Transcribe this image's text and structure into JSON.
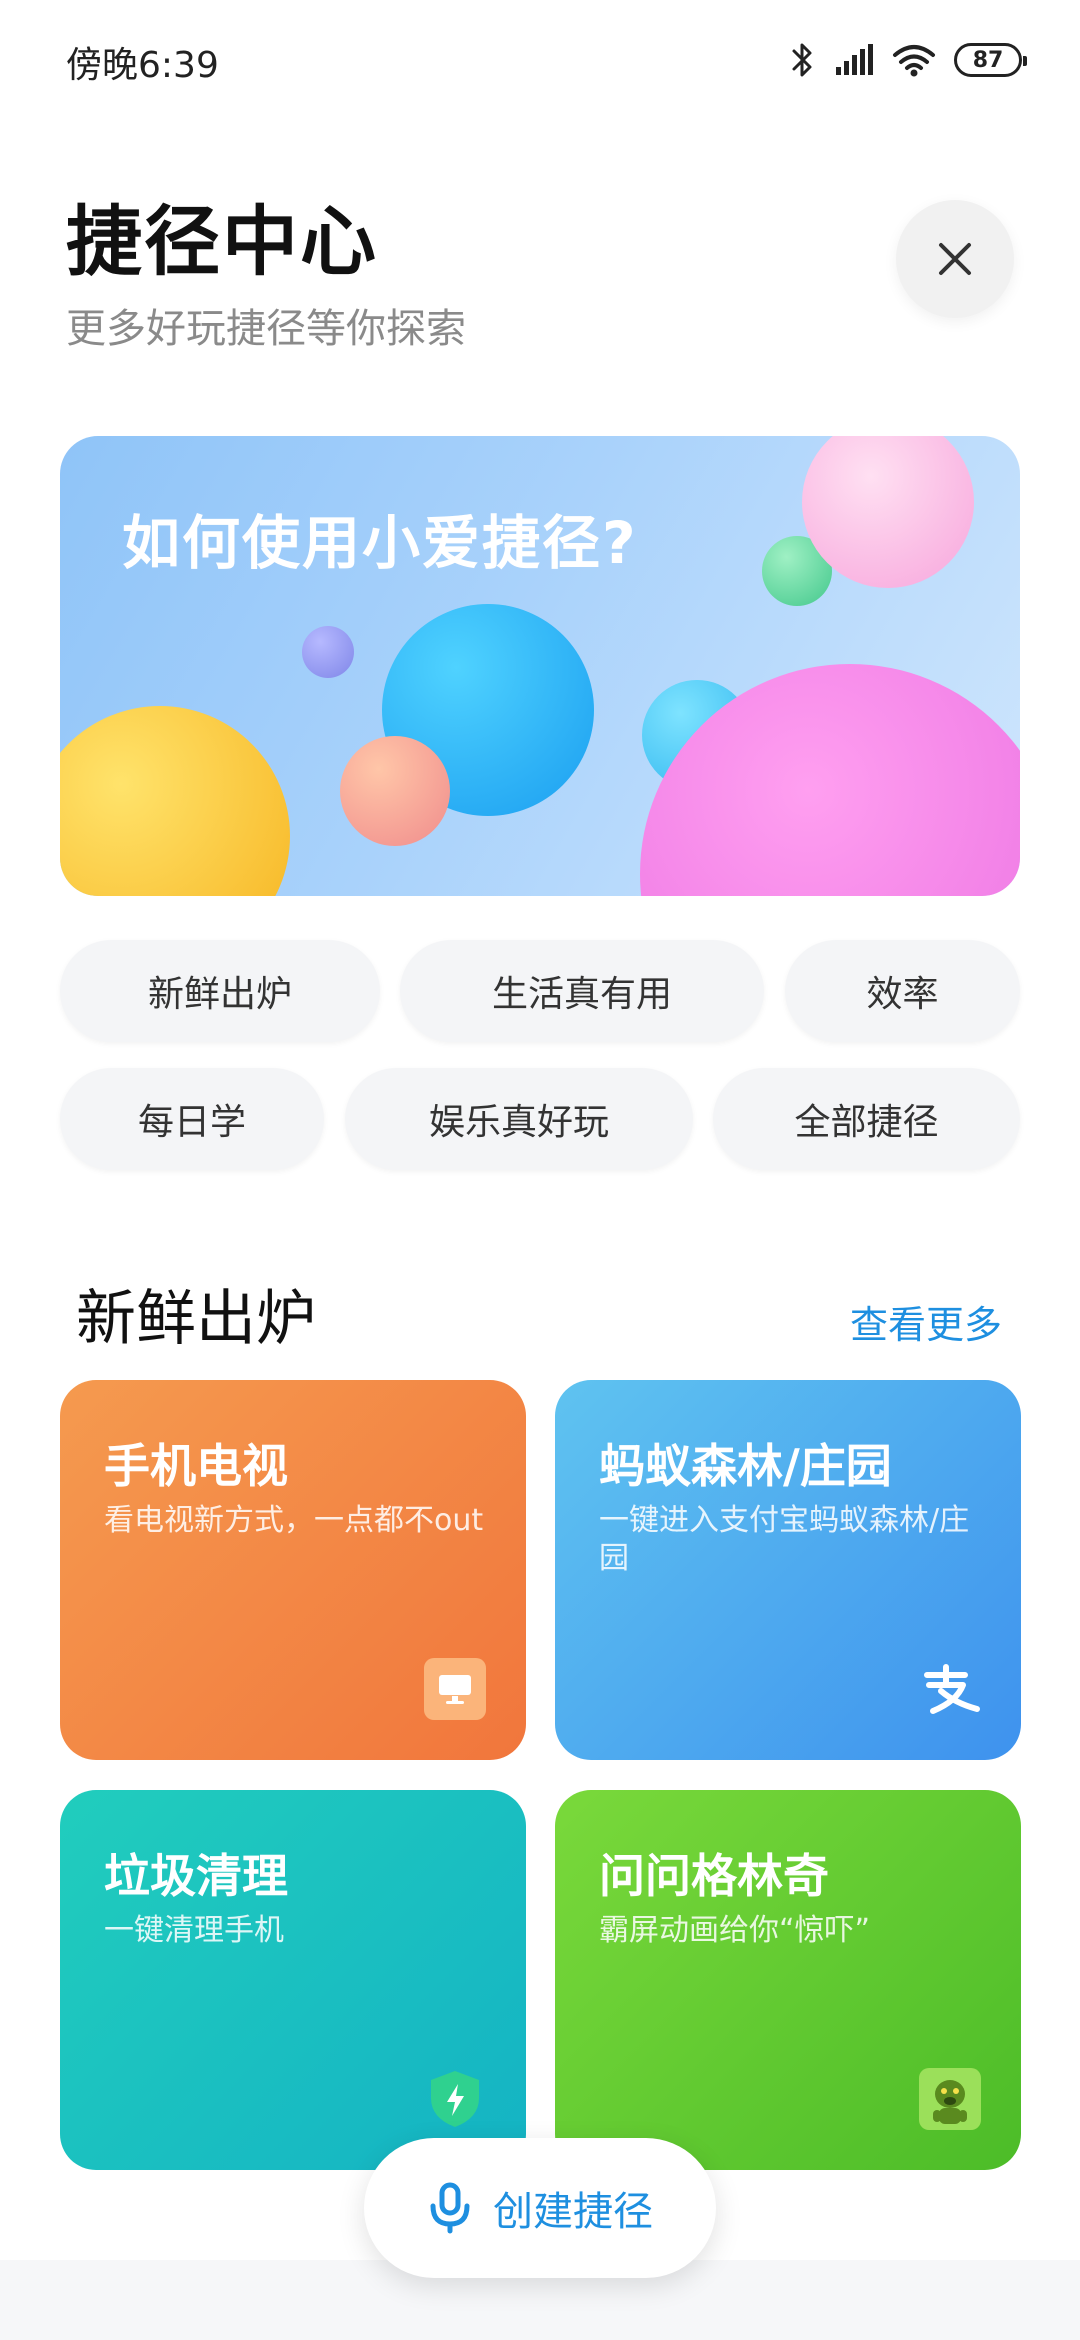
{
  "status": {
    "time": "傍晚6:39",
    "battery": "87",
    "icons": [
      "bluetooth-icon",
      "signal-icon",
      "wifi-icon",
      "battery-icon"
    ]
  },
  "header": {
    "title": "捷径中心",
    "subtitle": "更多好玩捷径等你探索",
    "close_icon": "close-icon"
  },
  "banner": {
    "title": "如何使用小爱捷径?"
  },
  "categories": [
    {
      "label": "新鲜出炉"
    },
    {
      "label": "生活真有用"
    },
    {
      "label": "效率"
    },
    {
      "label": "每日学"
    },
    {
      "label": "娱乐真好玩"
    },
    {
      "label": "全部捷径"
    }
  ],
  "section": {
    "title": "新鲜出炉",
    "see_more": "查看更多"
  },
  "cards": [
    {
      "title": "手机电视",
      "desc": "看电视新方式，一点都不out",
      "icon": "tv-icon",
      "colors": [
        "#f59a4f",
        "#f1763c"
      ]
    },
    {
      "title": "蚂蚁森林/庄园",
      "desc": "一键进入支付宝蚂蚁森林/庄园",
      "icon": "alipay-icon",
      "colors": [
        "#5fc3f0",
        "#3e92ee"
      ]
    },
    {
      "title": "垃圾清理",
      "desc": "一键清理手机",
      "icon": "shield-bolt-icon",
      "colors": [
        "#21cdbd",
        "#14b3c4"
      ]
    },
    {
      "title": "问问格林奇",
      "desc": "霸屏动画给你“惊吓”",
      "icon": "grinch-icon",
      "colors": [
        "#7ad93b",
        "#4cbc28"
      ]
    }
  ],
  "create_button": {
    "label": "创建捷径",
    "icon": "microphone-icon"
  },
  "accent_color": "#1e8fe0"
}
